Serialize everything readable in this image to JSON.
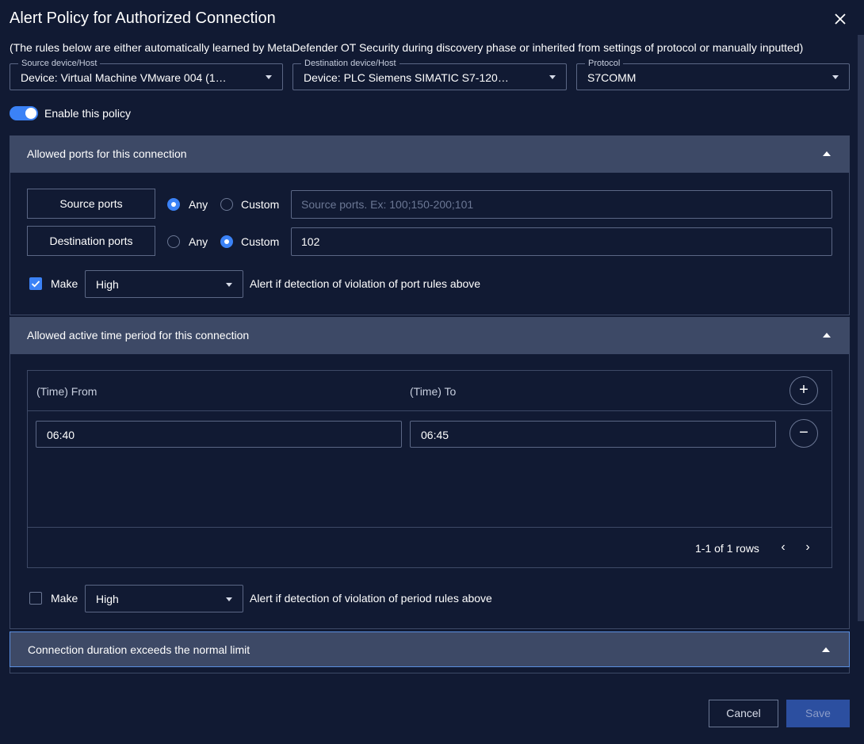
{
  "dialog": {
    "title": "Alert Policy for Authorized Connection",
    "subtitle": "(The rules below are either automatically learned by MetaDefender OT Security during discovery phase or inherited from settings of protocol or manually inputted)"
  },
  "source": {
    "legend": "Source device/Host",
    "value": "Device: Virtual Machine VMware 004 (1…"
  },
  "destination": {
    "legend": "Destination device/Host",
    "value": "Device: PLC Siemens SIMATIC S7-120…"
  },
  "protocol": {
    "legend": "Protocol",
    "value": "S7COMM"
  },
  "enable": {
    "label": "Enable this policy",
    "on": true
  },
  "ports_section": {
    "title": "Allowed ports for this connection",
    "source_label": "Source ports",
    "dest_label": "Destination ports",
    "any": "Any",
    "custom": "Custom",
    "source_selected": "Any",
    "dest_selected": "Custom",
    "source_placeholder": "Source ports. Ex: 100;150-200;101",
    "dest_value": "102",
    "make": "Make",
    "severity": "High",
    "checked": true,
    "alert_text": "Alert if detection of violation of port rules above"
  },
  "time_section": {
    "title": "Allowed active time period for this connection",
    "col_from": "(Time) From",
    "col_to": "(Time) To",
    "rows": [
      {
        "from": "06:40",
        "to": "06:45"
      }
    ],
    "pager": "1-1 of 1 rows",
    "make": "Make",
    "severity": "High",
    "checked": false,
    "alert_text": "Alert if detection of violation of period rules above"
  },
  "duration_section": {
    "title": "Connection duration exceeds the normal limit"
  },
  "footer": {
    "cancel": "Cancel",
    "save": "Save"
  },
  "icons": {
    "close": "close-icon",
    "add": "plus-icon",
    "remove": "minus-icon"
  },
  "colors": {
    "accent": "#3b82f6",
    "background": "#111a33",
    "section": "#3d4966"
  }
}
